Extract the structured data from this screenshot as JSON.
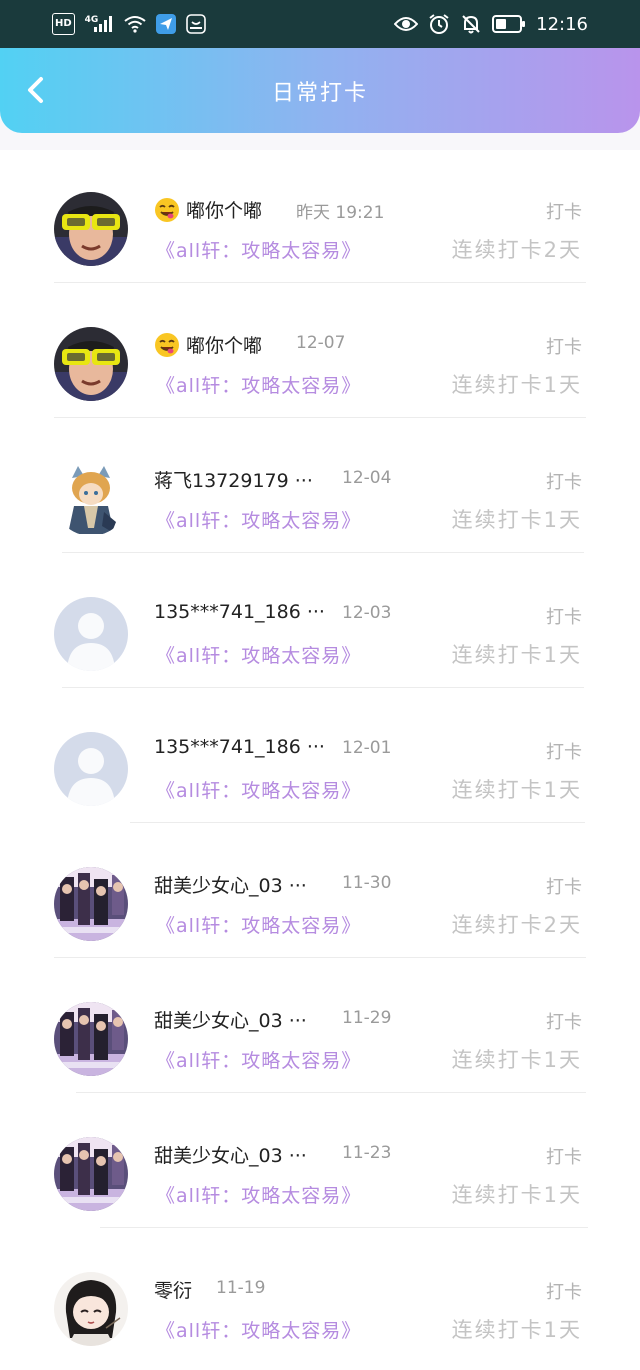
{
  "status_bar": {
    "left_icons": [
      "hd-badge",
      "4g-signal-icon",
      "wifi-icon",
      "send-icon",
      "app-icon"
    ],
    "net_label": "4G",
    "hd_label": "HD",
    "right_icons": [
      "eye-icon",
      "alarm-icon",
      "bell-off-icon",
      "battery-icon"
    ],
    "time": "12:16"
  },
  "header": {
    "title": "日常打卡",
    "back_icon": "chevron-left-icon",
    "gradient": [
      "#52d1f3",
      "#b994ec"
    ]
  },
  "colors": {
    "course": "#b58be0",
    "name": "#222222",
    "muted": "#9a9a9a"
  },
  "records": [
    {
      "emoji": true,
      "name": "嘟你个嘟",
      "time": "昨天 19:21",
      "course": "《all轩：攻略太容易》",
      "action": "打卡",
      "streak": "连续打卡2天",
      "avatar": "girl-glasses"
    },
    {
      "emoji": true,
      "name": "嘟你个嘟",
      "time": "12-07",
      "course": "《all轩：攻略太容易》",
      "action": "打卡",
      "streak": "连续打卡1天",
      "avatar": "girl-glasses"
    },
    {
      "emoji": false,
      "name": "蒋飞13729179 ···",
      "time": "12-04",
      "course": "《all轩：攻略太容易》",
      "action": "打卡",
      "streak": "连续打卡1天",
      "avatar": "anime-boy"
    },
    {
      "emoji": false,
      "name": "135***741_186 ···",
      "time": "12-03",
      "course": "《all轩：攻略太容易》",
      "action": "打卡",
      "streak": "连续打卡1天",
      "avatar": "default"
    },
    {
      "emoji": false,
      "name": "135***741_186 ···",
      "time": "12-01",
      "course": "《all轩：攻略太容易》",
      "action": "打卡",
      "streak": "连续打卡1天",
      "avatar": "default"
    },
    {
      "emoji": false,
      "name": "甜美少女心_03 ···",
      "time": "11-30",
      "course": "《all轩：攻略太容易》",
      "action": "打卡",
      "streak": "连续打卡2天",
      "avatar": "photo-group"
    },
    {
      "emoji": false,
      "name": "甜美少女心_03 ···",
      "time": "11-29",
      "course": "《all轩：攻略太容易》",
      "action": "打卡",
      "streak": "连续打卡1天",
      "avatar": "photo-group"
    },
    {
      "emoji": false,
      "name": "甜美少女心_03 ···",
      "time": "11-23",
      "course": "《all轩：攻略太容易》",
      "action": "打卡",
      "streak": "连续打卡1天",
      "avatar": "photo-group"
    },
    {
      "emoji": false,
      "name": "零衍",
      "time": "11-19",
      "course": "《all轩：攻略太容易》",
      "action": "打卡",
      "streak": "连续打卡1天",
      "avatar": "chibi"
    }
  ]
}
